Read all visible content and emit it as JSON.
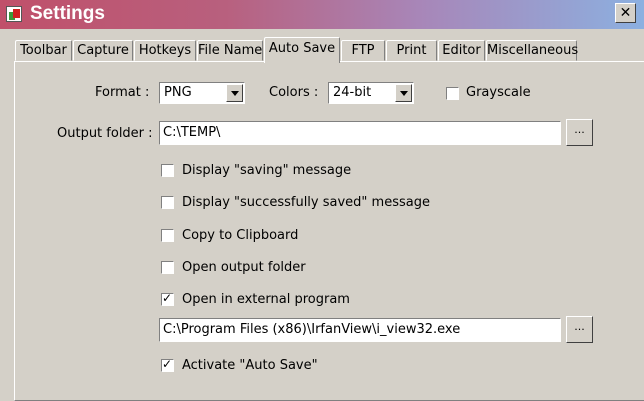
{
  "window": {
    "title": "Settings",
    "close_glyph": "✕"
  },
  "tabs": [
    {
      "label": "Toolbar"
    },
    {
      "label": "Capture"
    },
    {
      "label": "Hotkeys"
    },
    {
      "label": "File Name"
    },
    {
      "label": "Auto Save"
    },
    {
      "label": "FTP"
    },
    {
      "label": "Print"
    },
    {
      "label": "Editor"
    },
    {
      "label": "Miscellaneous"
    }
  ],
  "active_tab": "Auto Save",
  "format": {
    "label": "Format :",
    "value": "PNG"
  },
  "colors": {
    "label": "Colors :",
    "value": "24-bit"
  },
  "grayscale": {
    "label": "Grayscale",
    "checked": false
  },
  "output_folder": {
    "label": "Output folder :",
    "value": "C:\\TEMP\\",
    "browse_label": "..."
  },
  "options": [
    {
      "label": "Display \"saving\" message",
      "checked": false
    },
    {
      "label": "Display \"successfully saved\" message",
      "checked": false
    },
    {
      "label": "Copy to Clipboard",
      "checked": false
    },
    {
      "label": "Open output folder",
      "checked": false
    },
    {
      "label": "Open in external program",
      "checked": true
    }
  ],
  "external_program": {
    "value": "C:\\Program Files (x86)\\IrfanView\\i_view32.exe",
    "browse_label": "..."
  },
  "activate_auto_save": {
    "label": "Activate \"Auto Save\"",
    "checked": true
  },
  "check_glyph": "✓"
}
